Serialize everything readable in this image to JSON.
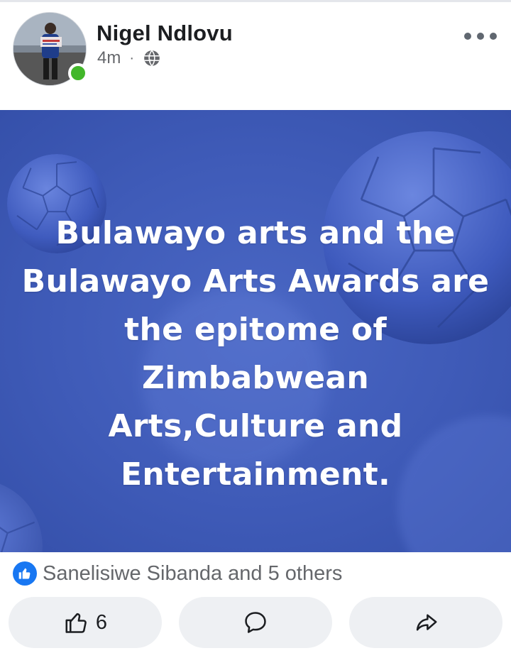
{
  "post": {
    "author": "Nigel Ndlovu",
    "time": "4m",
    "separator": "·",
    "privacy_icon": "globe-icon",
    "body_text": "Bulawayo arts and the\nBulawayo Arts Awards are\nthe epitome of Zimbabwean\nArts,Culture and\nEntertainment.",
    "background_color": "#3f5bb8"
  },
  "reactions": {
    "icon": "like-icon",
    "summary": "Sanelisiwe Sibanda and 5 others"
  },
  "actions": {
    "like_icon": "thumbs-up-icon",
    "like_count": "6",
    "comment_icon": "comment-bubble-icon",
    "share_icon": "share-arrow-icon"
  },
  "colors": {
    "brand_blue": "#1877f2",
    "online_green": "#42b72a",
    "muted_text": "#65676b"
  }
}
